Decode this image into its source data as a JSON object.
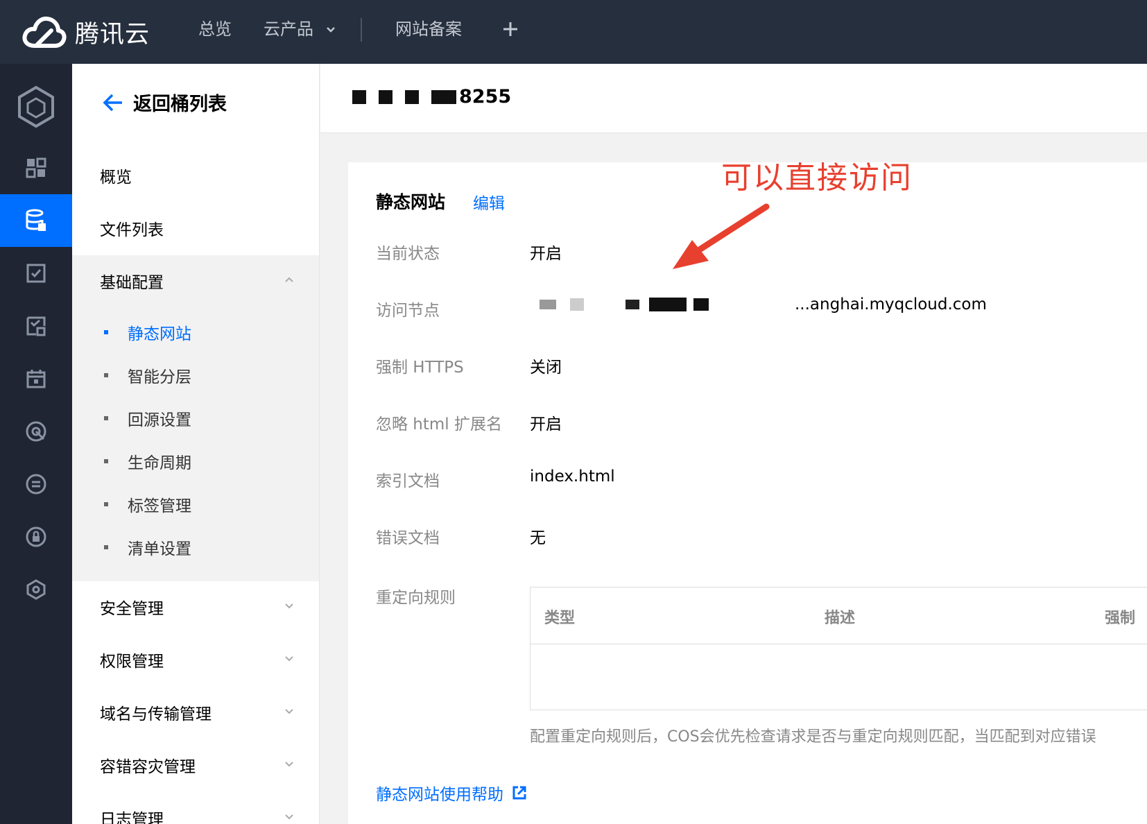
{
  "topbar": {
    "brand": "腾讯云",
    "nav": [
      "总览",
      "云产品",
      "网站备案"
    ],
    "add_icon": "plus-icon"
  },
  "rail": {
    "icons": [
      "cube-icon",
      "grid-icon",
      "storage-bucket-icon",
      "checklist-icon",
      "report-icon",
      "calendar-icon",
      "target-icon",
      "list-circle-icon",
      "lock-circle-icon",
      "hexagon-icon"
    ],
    "active_index": 2
  },
  "menu": {
    "back_label": "返回桶列表",
    "items": {
      "overview": "概览",
      "file_list": "文件列表",
      "basic_config": "基础配置",
      "security": "安全管理",
      "permission": "权限管理",
      "domain": "域名与传输管理",
      "disaster": "容错容灾管理",
      "log": "日志管理"
    },
    "sub_items": [
      "静态网站",
      "智能分层",
      "回源设置",
      "生命周期",
      "标签管理",
      "清单设置"
    ],
    "active_sub": "静态网站"
  },
  "header": {
    "bucket_name_visible": "8255"
  },
  "content": {
    "section_title": "静态网站",
    "edit_label": "编辑",
    "annotation": "可以直接访问",
    "fields": [
      {
        "label": "当前状态",
        "value": "开启"
      },
      {
        "label": "访问节点",
        "value": "...anghai.myqcloud.com"
      },
      {
        "label": "强制 HTTPS",
        "value": "关闭"
      },
      {
        "label": "忽略 html 扩展名",
        "value": "开启"
      },
      {
        "label": "索引文档",
        "value": "index.html"
      },
      {
        "label": "错误文档",
        "value": "无"
      },
      {
        "label": "重定向规则",
        "value": ""
      }
    ],
    "table_headers": [
      "类型",
      "描述",
      "强制"
    ],
    "hint": "配置重定向规则后，COS会优先检查请求是否与重定向规则匹配，当匹配到对应错误",
    "help_link": "静态网站使用帮助"
  },
  "colors": {
    "topbar": "#262f3e",
    "rail": "#1f2532",
    "accent": "#006eff",
    "annotation": "#e8402f"
  }
}
